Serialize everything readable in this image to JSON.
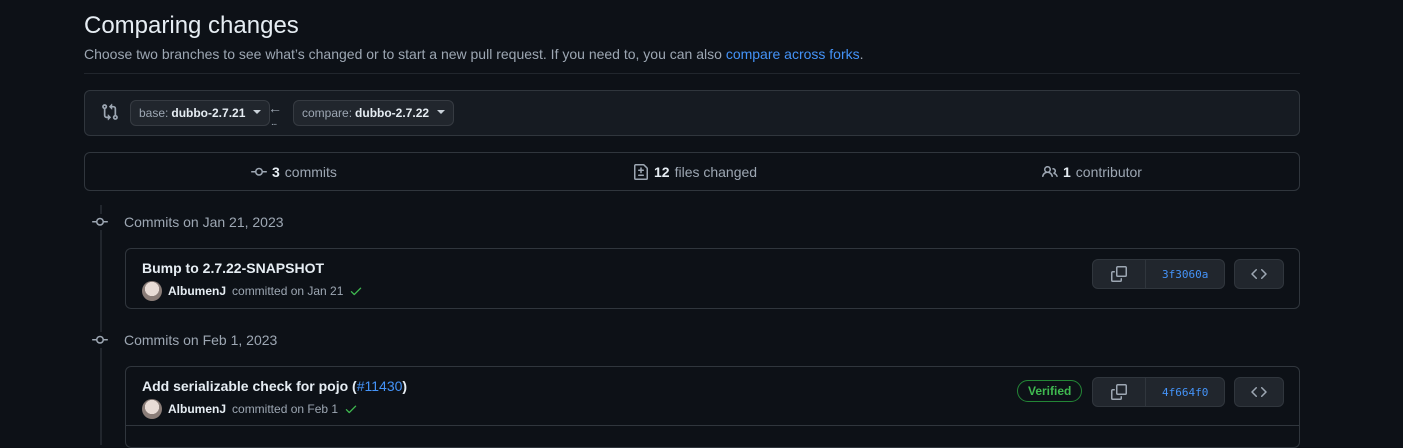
{
  "header": {
    "title": "Comparing changes",
    "subtitle": "Choose two branches to see what’s changed or to start a new pull request. If you need to, you can also ",
    "subtitle_link": "compare across forks",
    "subtitle_end": "."
  },
  "range": {
    "base_key": "base:",
    "base_value": "dubbo-2.7.21",
    "compare_key": "compare:",
    "compare_value": "dubbo-2.7.22",
    "arrow": "←",
    "dots": "..."
  },
  "stats": {
    "commits_count": "3",
    "commits_label": "commits",
    "files_count": "12",
    "files_label": "files changed",
    "contributors_count": "1",
    "contributors_label": "contributor"
  },
  "days": [
    {
      "heading": "Commits on Jan 21, 2023",
      "commits": [
        {
          "title": "Bump to 2.7.22-SNAPSHOT",
          "author": "AlbumenJ",
          "meta": "committed on Jan 21",
          "sha": "3f3060a",
          "verified": ""
        }
      ]
    },
    {
      "heading": "Commits on Feb 1, 2023",
      "commits": [
        {
          "title": "Add serializable check for pojo (",
          "pr_link": "#11430",
          "title_end": ")",
          "author": "AlbumenJ",
          "meta": "committed on Feb 1",
          "sha": "4f664f0",
          "verified": "Verified"
        }
      ]
    }
  ],
  "colors": {
    "background": "#0d1117",
    "link": "#4493f8",
    "success": "#3fb950",
    "border": "#30363d"
  }
}
